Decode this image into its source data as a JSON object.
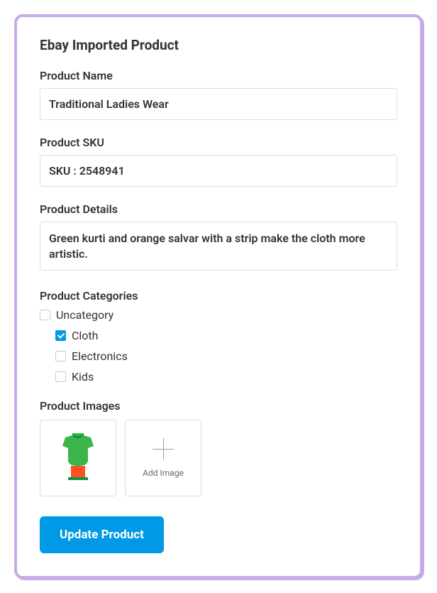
{
  "form": {
    "title": "Ebay Imported Product",
    "productName": {
      "label": "Product Name",
      "value": "Traditional Ladies Wear"
    },
    "productSku": {
      "label": "Product SKU",
      "value": "SKU : 2548941"
    },
    "productDetails": {
      "label": "Product Details",
      "value": "Green kurti and orange salvar with a strip make the cloth more artistic."
    },
    "categories": {
      "label": "Product Categories",
      "items": [
        {
          "label": "Uncategory",
          "checked": false,
          "indent": false
        },
        {
          "label": "Cloth",
          "checked": true,
          "indent": true
        },
        {
          "label": "Electronics",
          "checked": false,
          "indent": true
        },
        {
          "label": "Kids",
          "checked": false,
          "indent": true
        }
      ]
    },
    "images": {
      "label": "Product Images",
      "addLabel": "Add Image"
    },
    "submitLabel": "Update Product"
  }
}
